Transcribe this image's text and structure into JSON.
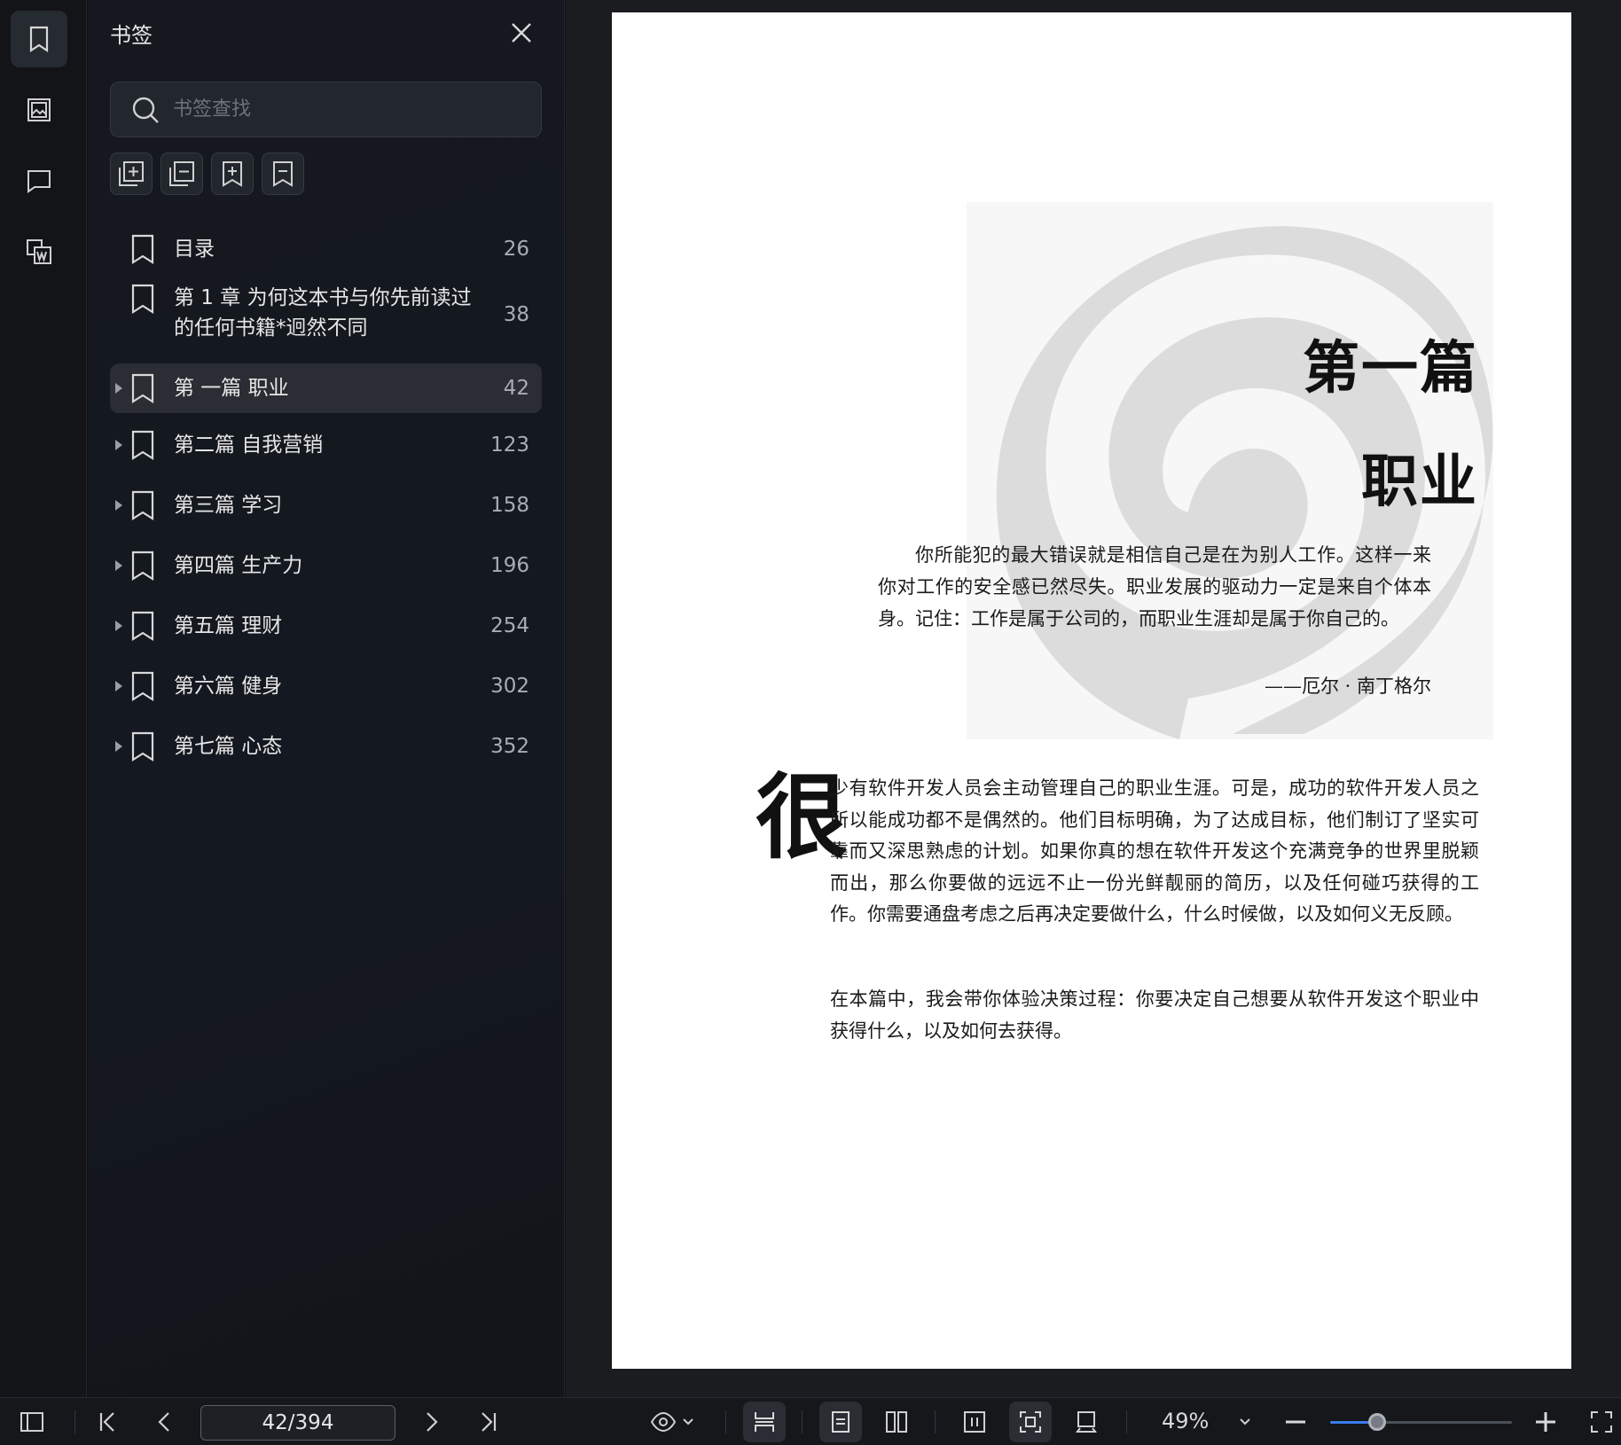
{
  "rail": {
    "items": [
      {
        "name": "bookmark",
        "active": true
      },
      {
        "name": "thumbnail",
        "active": false
      },
      {
        "name": "comment",
        "active": false
      },
      {
        "name": "convert-word",
        "active": false
      }
    ]
  },
  "panel": {
    "title": "书签",
    "search_placeholder": "书签查找",
    "tools": [
      "add-bookmark",
      "remove-bookmark",
      "expand-bookmark",
      "collapse-bookmark"
    ]
  },
  "bookmarks": [
    {
      "label": "目录",
      "page": "26",
      "has_children": false,
      "selected": false
    },
    {
      "label": "第 1 章 为何这本书与你先前读过的任何书籍*迥然不同",
      "page": "38",
      "has_children": false,
      "selected": false
    },
    {
      "label": "第 一篇 职业",
      "page": "42",
      "has_children": true,
      "selected": true
    },
    {
      "label": "第二篇 自我营销",
      "page": "123",
      "has_children": true,
      "selected": false
    },
    {
      "label": "第三篇 学习",
      "page": "158",
      "has_children": true,
      "selected": false
    },
    {
      "label": "第四篇 生产力",
      "page": "196",
      "has_children": true,
      "selected": false
    },
    {
      "label": "第五篇 理财",
      "page": "254",
      "has_children": true,
      "selected": false
    },
    {
      "label": "第六篇 健身",
      "page": "302",
      "has_children": true,
      "selected": false
    },
    {
      "label": "第七篇 心态",
      "page": "352",
      "has_children": true,
      "selected": false
    }
  ],
  "document": {
    "part_title": "第一篇",
    "part_name": "职业",
    "quote": "你所能犯的最大错误就是相信自己是在为别人工作。这样一来你对工作的安全感已然尽失。职业发展的驱动力一定是来自个体本身。记住：工作是属于公司的，而职业生涯却是属于你自己的。",
    "quote_author": "——厄尔 · 南丁格尔",
    "dropcap": "很",
    "paragraph1": "少有软件开发人员会主动管理自己的职业生涯。可是，成功的软件开发人员之所以能成功都不是偶然的。他们目标明确，为了达成目标，他们制订了坚实可靠而又深思熟虑的计划。如果你真的想在软件开发这个充满竞争的世界里脱颖而出，那么你要做的远远不止一份光鲜靓丽的简历，以及任何碰巧获得的工作。你需要通盘考虑之后再决定要做什么，什么时候做，以及如何义无反顾。",
    "paragraph2": "在本篇中，我会带你体验决策过程：你要决定自己想要从软件开发这个职业中获得什么，以及如何去获得。"
  },
  "statusbar": {
    "page_value": "42/394",
    "zoom_label": "49%",
    "zoom_fraction": 0.26
  },
  "colors": {
    "accent": "#3b7cf0",
    "page_bg": "#ffffff",
    "panel_bg": "#15181e"
  }
}
